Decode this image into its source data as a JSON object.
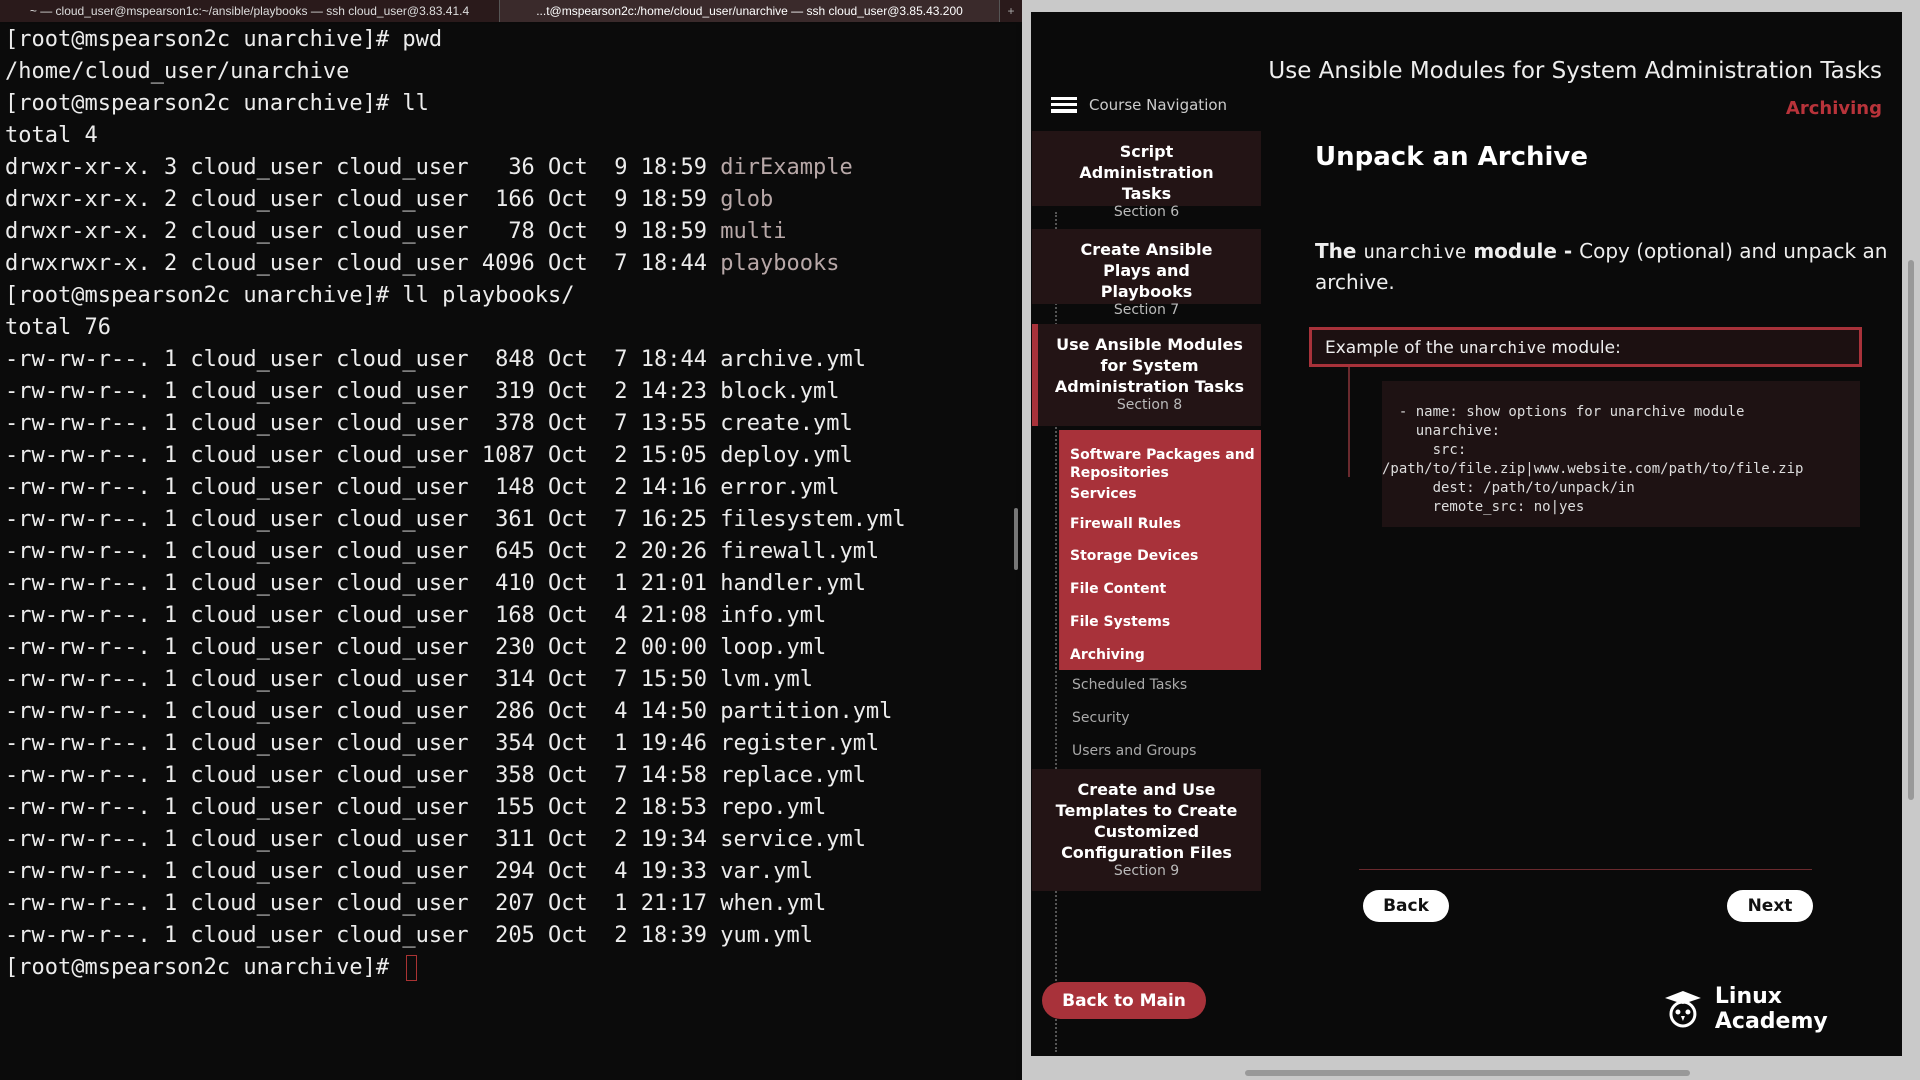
{
  "tabs": [
    {
      "label": "~ — cloud_user@mspearson1c:~/ansible/playbooks — ssh cloud_user@3.83.41.4"
    },
    {
      "label": "...t@mspearson2c:/home/cloud_user/unarchive — ssh cloud_user@3.85.43.200"
    }
  ],
  "terminal": {
    "lines": [
      {
        "text": "[root@mspearson2c unarchive]# pwd"
      },
      {
        "text": "/home/cloud_user/unarchive"
      },
      {
        "text": "[root@mspearson2c unarchive]# ll"
      },
      {
        "text": "total 4"
      },
      {
        "text": "drwxr-xr-x. 3 cloud_user cloud_user   36 Oct  9 18:59 ",
        "dir": "dirExample"
      },
      {
        "text": "drwxr-xr-x. 2 cloud_user cloud_user  166 Oct  9 18:59 ",
        "dir": "glob"
      },
      {
        "text": "drwxr-xr-x. 2 cloud_user cloud_user   78 Oct  9 18:59 ",
        "dir": "multi"
      },
      {
        "text": "drwxrwxr-x. 2 cloud_user cloud_user 4096 Oct  7 18:44 ",
        "dir": "playbooks"
      },
      {
        "text": "[root@mspearson2c unarchive]# ll playbooks/"
      },
      {
        "text": "total 76"
      },
      {
        "text": "-rw-rw-r--. 1 cloud_user cloud_user  848 Oct  7 18:44 archive.yml"
      },
      {
        "text": "-rw-rw-r--. 1 cloud_user cloud_user  319 Oct  2 14:23 block.yml"
      },
      {
        "text": "-rw-rw-r--. 1 cloud_user cloud_user  378 Oct  7 13:55 create.yml"
      },
      {
        "text": "-rw-rw-r--. 1 cloud_user cloud_user 1087 Oct  2 15:05 deploy.yml"
      },
      {
        "text": "-rw-rw-r--. 1 cloud_user cloud_user  148 Oct  2 14:16 error.yml"
      },
      {
        "text": "-rw-rw-r--. 1 cloud_user cloud_user  361 Oct  7 16:25 filesystem.yml"
      },
      {
        "text": "-rw-rw-r--. 1 cloud_user cloud_user  645 Oct  2 20:26 firewall.yml"
      },
      {
        "text": "-rw-rw-r--. 1 cloud_user cloud_user  410 Oct  1 21:01 handler.yml"
      },
      {
        "text": "-rw-rw-r--. 1 cloud_user cloud_user  168 Oct  4 21:08 info.yml"
      },
      {
        "text": "-rw-rw-r--. 1 cloud_user cloud_user  230 Oct  2 00:00 loop.yml"
      },
      {
        "text": "-rw-rw-r--. 1 cloud_user cloud_user  314 Oct  7 15:50 lvm.yml"
      },
      {
        "text": "-rw-rw-r--. 1 cloud_user cloud_user  286 Oct  4 14:50 partition.yml"
      },
      {
        "text": "-rw-rw-r--. 1 cloud_user cloud_user  354 Oct  1 19:46 register.yml"
      },
      {
        "text": "-rw-rw-r--. 1 cloud_user cloud_user  358 Oct  7 14:58 replace.yml"
      },
      {
        "text": "-rw-rw-r--. 1 cloud_user cloud_user  155 Oct  2 18:53 repo.yml"
      },
      {
        "text": "-rw-rw-r--. 1 cloud_user cloud_user  311 Oct  2 19:34 service.yml"
      },
      {
        "text": "-rw-rw-r--. 1 cloud_user cloud_user  294 Oct  4 19:33 var.yml"
      },
      {
        "text": "-rw-rw-r--. 1 cloud_user cloud_user  207 Oct  1 21:17 when.yml"
      },
      {
        "text": "-rw-rw-r--. 1 cloud_user cloud_user  205 Oct  2 18:39 yum.yml"
      }
    ],
    "prompt": "[root@mspearson2c unarchive]# "
  },
  "course": {
    "title": "Use Ansible Modules for System Administration Tasks",
    "lesson_tag": "Archiving",
    "nav_label": "Course Navigation",
    "sections": [
      {
        "title": "Script Administration Tasks",
        "sub": "Section 6"
      },
      {
        "title": "Create Ansible Plays and Playbooks",
        "sub": "Section 7"
      },
      {
        "title": "Use Ansible Modules for System Administration Tasks",
        "sub": "Section 8"
      },
      {
        "title": "Create and Use Templates to Create Customized Configuration Files",
        "sub": "Section 9"
      }
    ],
    "lessons": [
      "Software Packages and Repositories",
      "Services",
      "Firewall Rules",
      "Storage Devices",
      "File Content",
      "File Systems",
      "Archiving"
    ],
    "other_lessons": [
      "Scheduled Tasks",
      "Security",
      "Users and Groups"
    ],
    "back_to_main": "Back to Main"
  },
  "content": {
    "heading": "Unpack an Archive",
    "desc_the": "The ",
    "desc_module": "unarchive",
    "desc_bold": " module - ",
    "desc_rest": "Copy (optional) and unpack an archive.",
    "example_pre": "Example of the ",
    "example_mono": "unarchive",
    "example_post": " module:",
    "code": "  - name: show options for unarchive module\n    unarchive:\n      src:\n/path/to/file.zip|www.website.com/path/to/file.zip\n      dest: /path/to/unpack/in\n      remote_src: no|yes",
    "back": "Back",
    "next": "Next"
  },
  "brand": "Linux Academy"
}
